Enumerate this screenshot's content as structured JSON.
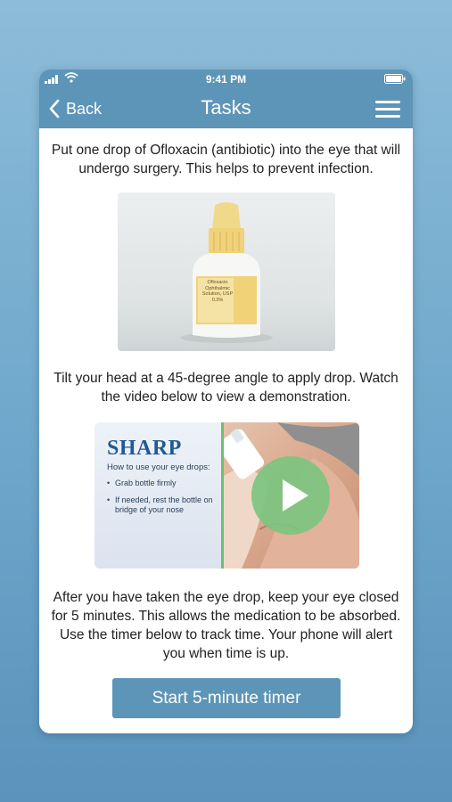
{
  "status_bar": {
    "time": "9:41 PM"
  },
  "nav": {
    "back_label": "Back",
    "title": "Tasks",
    "icons": {
      "back": "chevron-left-icon",
      "menu": "hamburger-menu-icon"
    }
  },
  "content": {
    "instruction_1": "Put one drop of Ofloxacin (antibiotic) into the eye that will undergo surgery. This helps to prevent infection.",
    "bottle_label": {
      "line1": "Ofloxacin",
      "line2": "Ophthalmic",
      "line3": "Solution, USP",
      "line4": "0.3%"
    },
    "instruction_2": "Tilt your head at a 45-degree angle to apply drop. Watch the video below to view a demonstration.",
    "video": {
      "brand": "SHARP",
      "heading": "How to use your eye drops:",
      "bullets": [
        "Grab bottle firmly",
        "If needed, rest the bottle on bridge of your nose"
      ]
    },
    "instruction_3": "After you have taken the eye drop, keep your eye closed for 5 minutes. This allows the medication to be absorbed. Use the timer below to track time. Your phone will alert you when time is up.",
    "timer_button_label": "Start 5-minute timer"
  },
  "colors": {
    "background": "#7bb0d2",
    "header": "#5d95b8",
    "button": "#5d95b8",
    "play_button": "#7cc47f",
    "text": "#222222"
  }
}
